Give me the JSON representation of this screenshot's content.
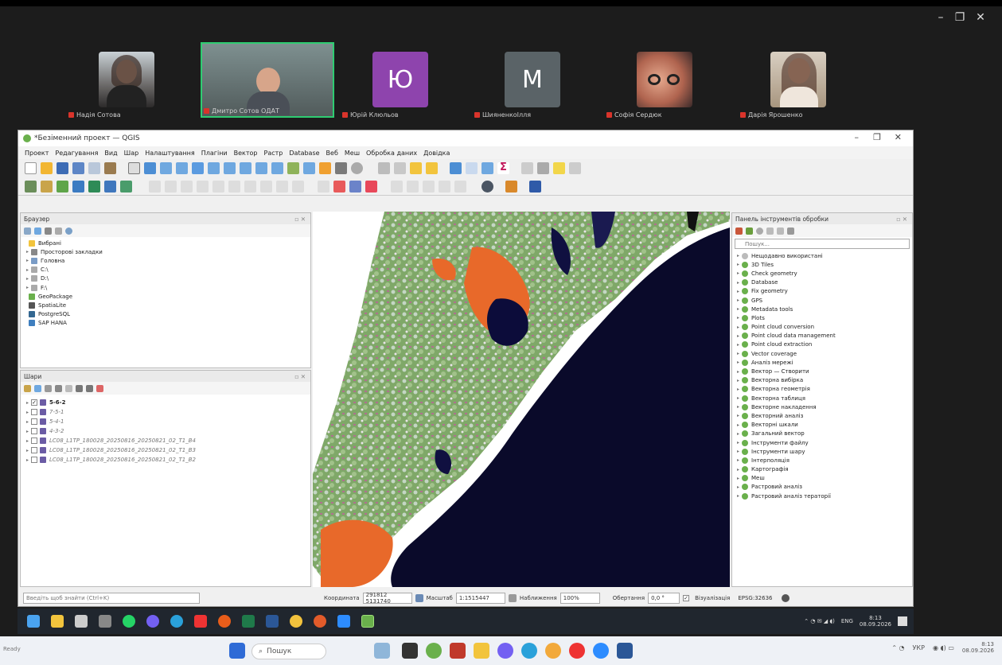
{
  "meeting": {
    "participants": [
      {
        "name": "Надія Сотова",
        "letter": ""
      },
      {
        "name": "Дмитро Сотов ОДАТ",
        "letter": ""
      },
      {
        "name": "Юрій Клюльов",
        "letter": "Ю"
      },
      {
        "name": "ШияненкоІлля",
        "letter": "M"
      },
      {
        "name": "Софія Сердюк",
        "letter": ""
      },
      {
        "name": "Дарія Ярошенко",
        "letter": ""
      }
    ],
    "controls": [
      "–",
      "❐",
      "✕"
    ]
  },
  "qgis": {
    "title": "*Безіменний проект — QGIS",
    "window_controls": [
      "–",
      "❐",
      "✕"
    ],
    "menu": [
      "Проект",
      "Редагування",
      "Вид",
      "Шар",
      "Налаштування",
      "Плагіни",
      "Вектор",
      "Растр",
      "Database",
      "Веб",
      "Меш",
      "Обробка даних",
      "Довідка"
    ],
    "browser": {
      "title": "Браузер",
      "items": [
        {
          "label": "Вибрані",
          "arrow": "",
          "color": "#f2c43d"
        },
        {
          "label": "Просторові закладки",
          "arrow": "▸",
          "color": "#888"
        },
        {
          "label": "Головна",
          "arrow": "▸",
          "color": "#7a9cc6"
        },
        {
          "label": "C:\\",
          "arrow": "▸",
          "color": "#aaa"
        },
        {
          "label": "D:\\",
          "arrow": "▸",
          "color": "#aaa"
        },
        {
          "label": "F:\\",
          "arrow": "▸",
          "color": "#aaa"
        },
        {
          "label": "GeoPackage",
          "arrow": "",
          "color": "#6ab04c"
        },
        {
          "label": "SpatiaLite",
          "arrow": "",
          "color": "#555"
        },
        {
          "label": "PostgreSQL",
          "arrow": "",
          "color": "#336791"
        },
        {
          "label": "SAP HANA",
          "arrow": "",
          "color": "#3f7fbf"
        }
      ]
    },
    "layers": {
      "title": "Шари",
      "items": [
        {
          "label": "5-6-2",
          "checked": true,
          "bold": true
        },
        {
          "label": "7-5-1",
          "checked": false,
          "bold": false
        },
        {
          "label": "5-4-1",
          "checked": false,
          "bold": false
        },
        {
          "label": "4-3-2",
          "checked": false,
          "bold": false
        },
        {
          "label": "LC08_L1TP_180028_20250816_20250821_02_T1_B4",
          "checked": false,
          "bold": false
        },
        {
          "label": "LC08_L1TP_180028_20250816_20250821_02_T1_B3",
          "checked": false,
          "bold": false
        },
        {
          "label": "LC08_L1TP_180028_20250816_20250821_02_T1_B2",
          "checked": false,
          "bold": false
        }
      ]
    },
    "processing": {
      "title": "Панель інструментів обробки",
      "search_placeholder": "Пошук...",
      "items": [
        "Нещодавно використані",
        "3D Tiles",
        "Check geometry",
        "Database",
        "Fix geometry",
        "GPS",
        "Metadata tools",
        "Plots",
        "Point cloud conversion",
        "Point cloud data management",
        "Point cloud extraction",
        "Vector coverage",
        "Аналіз мережі",
        "Вектор — Створити",
        "Векторна вибірка",
        "Векторна геометрія",
        "Векторна таблиця",
        "Векторне накладення",
        "Векторний аналіз",
        "Векторні шкали",
        "Загальний вектор",
        "Інструменти файлу",
        "Інструменти шару",
        "Інтерполяція",
        "Картографія",
        "Меш",
        "Растровий аналіз",
        "Растровий аналіз тераторії"
      ]
    },
    "status": {
      "locator_placeholder": "Введіть щоб знайти (Ctrl+K)",
      "coord_label": "Координата",
      "coord_value": "291812 5131740",
      "scale_label": "Масштаб",
      "scale_value": "1:1515447",
      "magnifier_label": "Наближення",
      "magnifier_value": "100%",
      "rotation_label": "Обертання",
      "rotation_value": "0,0 °",
      "render_label": "Візуалізація",
      "crs": "EPSG:32636"
    },
    "taskbar_tray": {
      "lang": "ENG",
      "time": "8:13",
      "date": "08.09.2026"
    }
  },
  "desktop": {
    "status": "Ready",
    "search_label": "Пошук",
    "tray": {
      "lang": "УКР",
      "time": "8:13",
      "date": "08.09.2026"
    }
  }
}
